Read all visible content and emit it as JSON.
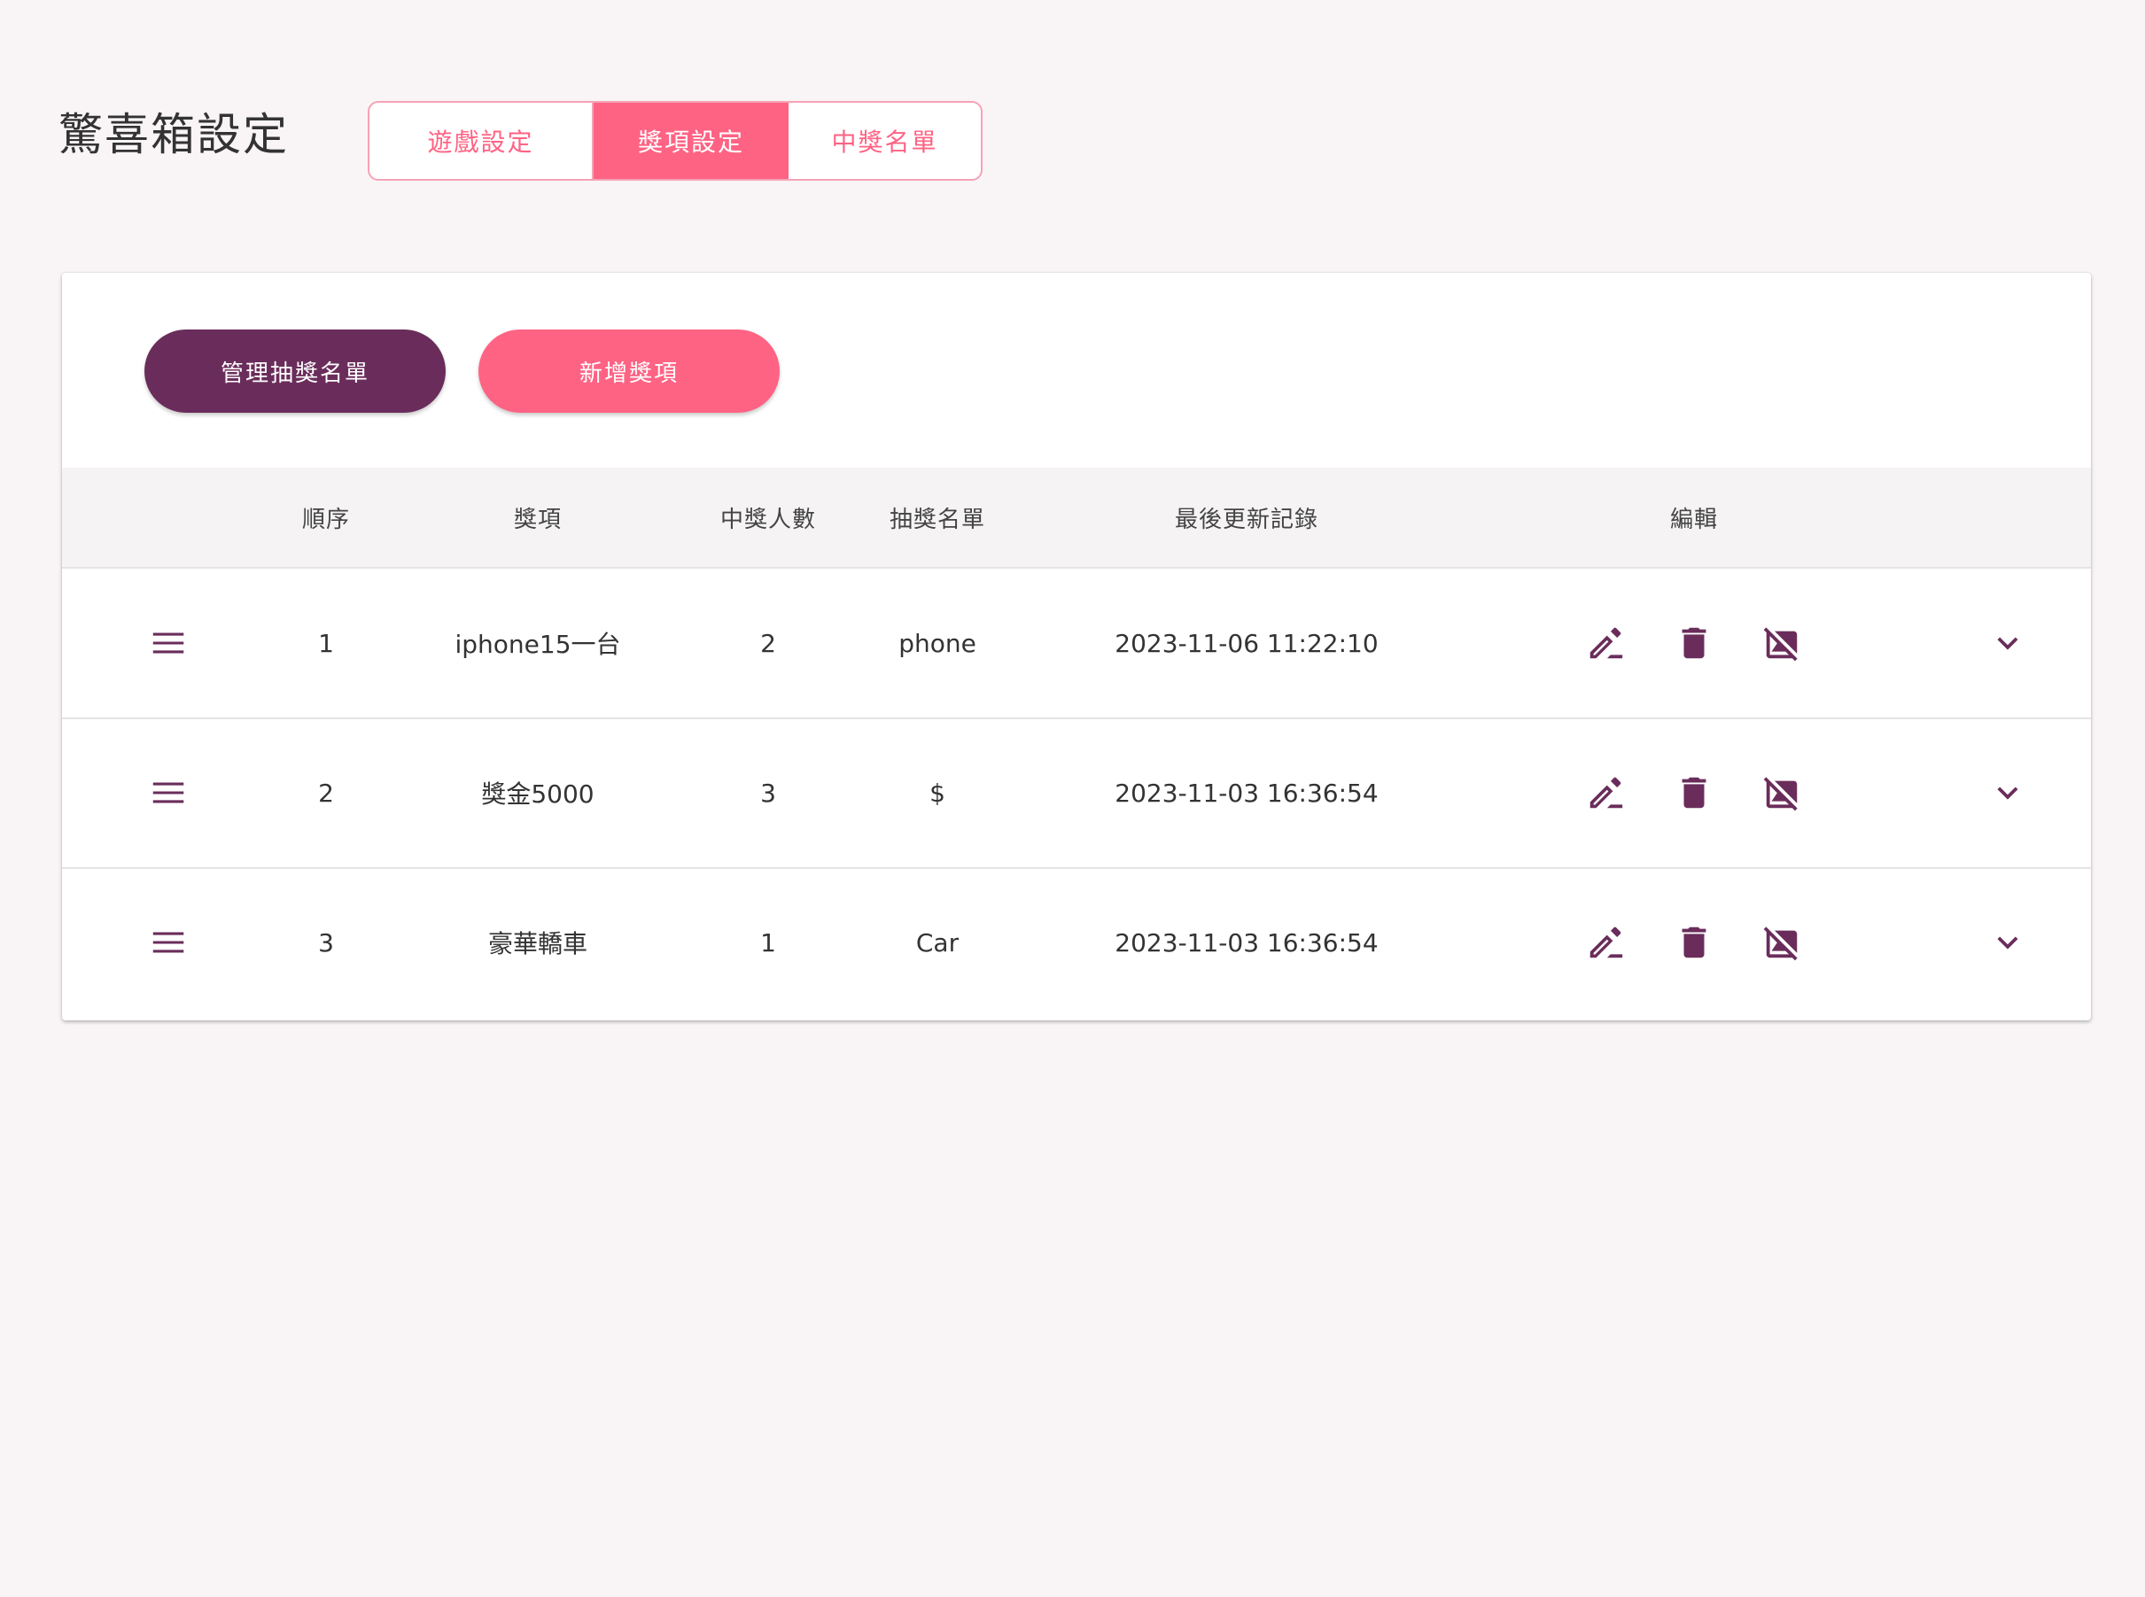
{
  "page": {
    "title": "驚喜箱設定"
  },
  "tabs": [
    {
      "label": "遊戲設定",
      "active": false
    },
    {
      "label": "獎項設定",
      "active": true
    },
    {
      "label": "中獎名單",
      "active": false
    }
  ],
  "toolbar": {
    "manage_label": "管理抽獎名單",
    "add_label": "新增獎項"
  },
  "table": {
    "headers": {
      "order": "順序",
      "prize": "獎項",
      "winners": "中獎人數",
      "list": "抽獎名單",
      "updated": "最後更新記錄",
      "edit": "編輯"
    },
    "rows": [
      {
        "order": "1",
        "prize": "iphone15一台",
        "winners": "2",
        "list": "phone",
        "updated": "2023-11-06 11:22:10"
      },
      {
        "order": "2",
        "prize": "獎金5000",
        "winners": "3",
        "list": "$",
        "updated": "2023-11-03 16:36:54"
      },
      {
        "order": "3",
        "prize": "豪華轎車",
        "winners": "1",
        "list": "Car",
        "updated": "2023-11-03 16:36:54"
      }
    ]
  },
  "icons": {
    "drag": "drag-handle-icon",
    "edit": "edit-pencil-icon",
    "delete": "trash-icon",
    "image": "hide-image-icon",
    "expand": "chevron-down-icon"
  },
  "colors": {
    "primary": "#ff6384",
    "dark": "#6a2d5b",
    "icon": "#6a2d5b",
    "background": "#f9f5f6"
  }
}
